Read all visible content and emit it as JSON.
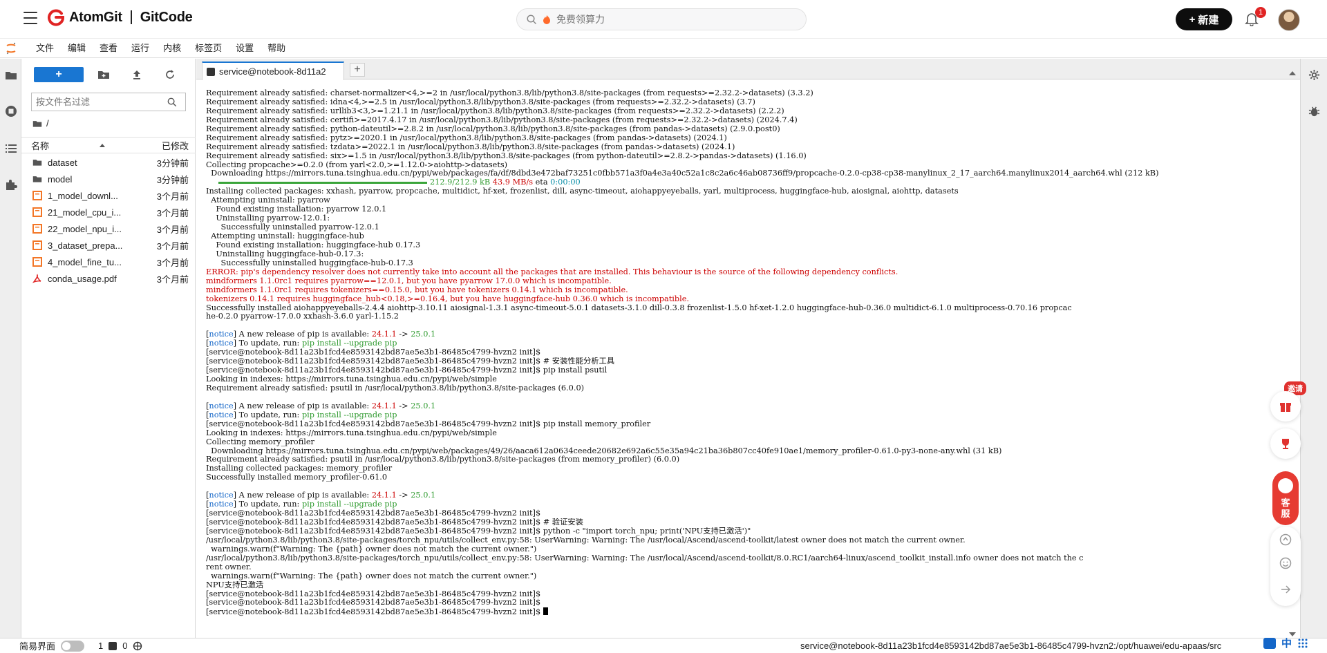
{
  "app": {
    "brand_left": "AtomGit",
    "brand_right": "GitCode",
    "search_placeholder": "免费领算力",
    "new_button": "新建",
    "notification_count": "1"
  },
  "menubar": [
    "文件",
    "编辑",
    "查看",
    "运行",
    "内核",
    "标签页",
    "设置",
    "帮助"
  ],
  "filebrowser": {
    "filter_placeholder": "按文件名过滤",
    "breadcrumb": "/",
    "col_name": "名称",
    "col_modified": "已修改",
    "files": [
      {
        "name": "dataset",
        "modified": "3分钟前",
        "type": "folder"
      },
      {
        "name": "model",
        "modified": "3分钟前",
        "type": "folder"
      },
      {
        "name": "1_model_downl...",
        "modified": "3个月前",
        "type": "notebook"
      },
      {
        "name": "21_model_cpu_i...",
        "modified": "3个月前",
        "type": "notebook"
      },
      {
        "name": "22_model_npu_i...",
        "modified": "3个月前",
        "type": "notebook"
      },
      {
        "name": "3_dataset_prepa...",
        "modified": "3个月前",
        "type": "notebook"
      },
      {
        "name": "4_model_fine_tu...",
        "modified": "3个月前",
        "type": "notebook"
      },
      {
        "name": "conda_usage.pdf",
        "modified": "3个月前",
        "type": "pdf"
      }
    ]
  },
  "terminal": {
    "tab_label": "service@notebook-8d11a2",
    "lines": [
      [
        {
          "t": "Requirement already satisfied: charset-normalizer<4,>=2 in /usr/local/python3.8/lib/python3.8/site-packages (from requests>=2.32.2->datasets) (3.3.2)"
        }
      ],
      [
        {
          "t": "Requirement already satisfied: idna<4,>=2.5 in /usr/local/python3.8/lib/python3.8/site-packages (from requests>=2.32.2->datasets) (3.7)"
        }
      ],
      [
        {
          "t": "Requirement already satisfied: urllib3<3,>=1.21.1 in /usr/local/python3.8/lib/python3.8/site-packages (from requests>=2.32.2->datasets) (2.2.2)"
        }
      ],
      [
        {
          "t": "Requirement already satisfied: certifi>=2017.4.17 in /usr/local/python3.8/lib/python3.8/site-packages (from requests>=2.32.2->datasets) (2024.7.4)"
        }
      ],
      [
        {
          "t": "Requirement already satisfied: python-dateutil>=2.8.2 in /usr/local/python3.8/lib/python3.8/site-packages (from pandas->datasets) (2.9.0.post0)"
        }
      ],
      [
        {
          "t": "Requirement already satisfied: pytz>=2020.1 in /usr/local/python3.8/lib/python3.8/site-packages (from pandas->datasets) (2024.1)"
        }
      ],
      [
        {
          "t": "Requirement already satisfied: tzdata>=2022.1 in /usr/local/python3.8/lib/python3.8/site-packages (from pandas->datasets) (2024.1)"
        }
      ],
      [
        {
          "t": "Requirement already satisfied: six>=1.5 in /usr/local/python3.8/lib/python3.8/site-packages (from python-dateutil>=2.8.2->pandas->datasets) (1.16.0)"
        }
      ],
      [
        {
          "t": "Collecting propcache>=0.2.0 (from yarl<2.0,>=1.12.0->aiohttp->datasets)"
        }
      ],
      [
        {
          "t": "  Downloading https://mirrors.tuna.tsinghua.edu.cn/pypi/web/packages/fa/df/8dbd3e472baf73251c0fbb571a3f0a4e3a40c52a1c8c2a6c46ab08736ff9/propcache-0.2.0-cp38-cp38-manylinux_2_17_aarch64.manylinux2014_aarch64.whl (212 kB)"
        }
      ],
      [
        {
          "t": "     "
        },
        {
          "bar": 1
        },
        {
          "t": "212.9/212.9 kB",
          "c": "c-green"
        },
        {
          "t": " "
        },
        {
          "t": "43.9 MB/s",
          "c": "c-red"
        },
        {
          "t": " eta "
        },
        {
          "t": "0:00:00",
          "c": "c-cyan"
        }
      ],
      [
        {
          "t": "Installing collected packages: xxhash, pyarrow, propcache, multidict, hf-xet, frozenlist, dill, async-timeout, aiohappyeyeballs, yarl, multiprocess, huggingface-hub, aiosignal, aiohttp, datasets"
        }
      ],
      [
        {
          "t": "  Attempting uninstall: pyarrow"
        }
      ],
      [
        {
          "t": "    Found existing installation: pyarrow 12.0.1"
        }
      ],
      [
        {
          "t": "    Uninstalling pyarrow-12.0.1:"
        }
      ],
      [
        {
          "t": "      Successfully uninstalled pyarrow-12.0.1"
        }
      ],
      [
        {
          "t": "  Attempting uninstall: huggingface-hub"
        }
      ],
      [
        {
          "t": "    Found existing installation: huggingface-hub 0.17.3"
        }
      ],
      [
        {
          "t": "    Uninstalling huggingface-hub-0.17.3:"
        }
      ],
      [
        {
          "t": "      Successfully uninstalled huggingface-hub-0.17.3"
        }
      ],
      [
        {
          "t": "ERROR: pip's dependency resolver does not currently take into account all the packages that are installed. This behaviour is the source of the following dependency conflicts.",
          "c": "c-red"
        }
      ],
      [
        {
          "t": "mindformers 1.1.0rc1 requires pyarrow==12.0.1, but you have pyarrow 17.0.0 which is incompatible.",
          "c": "c-red"
        }
      ],
      [
        {
          "t": "mindformers 1.1.0rc1 requires tokenizers==0.15.0, but you have tokenizers 0.14.1 which is incompatible.",
          "c": "c-red"
        }
      ],
      [
        {
          "t": "tokenizers 0.14.1 requires huggingface_hub<0.18,>=0.16.4, but you have huggingface-hub 0.36.0 which is incompatible.",
          "c": "c-red"
        }
      ],
      [
        {
          "t": "Successfully installed aiohappyeyeballs-2.4.4 aiohttp-3.10.11 aiosignal-1.3.1 async-timeout-5.0.1 datasets-3.1.0 dill-0.3.8 frozenlist-1.5.0 hf-xet-1.2.0 huggingface-hub-0.36.0 multidict-6.1.0 multiprocess-0.70.16 propcac"
        }
      ],
      [
        {
          "t": "he-0.2.0 pyarrow-17.0.0 xxhash-3.6.0 yarl-1.15.2"
        }
      ],
      [
        {
          "t": ""
        }
      ],
      [
        {
          "t": "["
        },
        {
          "t": "notice",
          "c": "c-blue"
        },
        {
          "t": "] A new release of pip is available: "
        },
        {
          "t": "24.1.1",
          "c": "c-red"
        },
        {
          "t": " -> "
        },
        {
          "t": "25.0.1",
          "c": "c-green"
        }
      ],
      [
        {
          "t": "["
        },
        {
          "t": "notice",
          "c": "c-blue"
        },
        {
          "t": "] To update, run: "
        },
        {
          "t": "pip install --upgrade pip",
          "c": "c-green"
        }
      ],
      [
        {
          "t": "[service@notebook-8d11a23b1fcd4e8593142bd87ae5e3b1-86485c4799-hvzn2 init]$"
        }
      ],
      [
        {
          "t": "[service@notebook-8d11a23b1fcd4e8593142bd87ae5e3b1-86485c4799-hvzn2 init]$ # 安装性能分析工具"
        }
      ],
      [
        {
          "t": "[service@notebook-8d11a23b1fcd4e8593142bd87ae5e3b1-86485c4799-hvzn2 init]$ pip install psutil"
        }
      ],
      [
        {
          "t": "Looking in indexes: https://mirrors.tuna.tsinghua.edu.cn/pypi/web/simple"
        }
      ],
      [
        {
          "t": "Requirement already satisfied: psutil in /usr/local/python3.8/lib/python3.8/site-packages (6.0.0)"
        }
      ],
      [
        {
          "t": ""
        }
      ],
      [
        {
          "t": "["
        },
        {
          "t": "notice",
          "c": "c-blue"
        },
        {
          "t": "] A new release of pip is available: "
        },
        {
          "t": "24.1.1",
          "c": "c-red"
        },
        {
          "t": " -> "
        },
        {
          "t": "25.0.1",
          "c": "c-green"
        }
      ],
      [
        {
          "t": "["
        },
        {
          "t": "notice",
          "c": "c-blue"
        },
        {
          "t": "] To update, run: "
        },
        {
          "t": "pip install --upgrade pip",
          "c": "c-green"
        }
      ],
      [
        {
          "t": "[service@notebook-8d11a23b1fcd4e8593142bd87ae5e3b1-86485c4799-hvzn2 init]$ pip install memory_profiler"
        }
      ],
      [
        {
          "t": "Looking in indexes: https://mirrors.tuna.tsinghua.edu.cn/pypi/web/simple"
        }
      ],
      [
        {
          "t": "Collecting memory_profiler"
        }
      ],
      [
        {
          "t": "  Downloading https://mirrors.tuna.tsinghua.edu.cn/pypi/web/packages/49/26/aaca612a0634ceede20682e692a6c55e35a94c21ba36b807cc40fe910ae1/memory_profiler-0.61.0-py3-none-any.whl (31 kB)"
        }
      ],
      [
        {
          "t": "Requirement already satisfied: psutil in /usr/local/python3.8/lib/python3.8/site-packages (from memory_profiler) (6.0.0)"
        }
      ],
      [
        {
          "t": "Installing collected packages: memory_profiler"
        }
      ],
      [
        {
          "t": "Successfully installed memory_profiler-0.61.0"
        }
      ],
      [
        {
          "t": ""
        }
      ],
      [
        {
          "t": "["
        },
        {
          "t": "notice",
          "c": "c-blue"
        },
        {
          "t": "] A new release of pip is available: "
        },
        {
          "t": "24.1.1",
          "c": "c-red"
        },
        {
          "t": " -> "
        },
        {
          "t": "25.0.1",
          "c": "c-green"
        }
      ],
      [
        {
          "t": "["
        },
        {
          "t": "notice",
          "c": "c-blue"
        },
        {
          "t": "] To update, run: "
        },
        {
          "t": "pip install --upgrade pip",
          "c": "c-green"
        }
      ],
      [
        {
          "t": "[service@notebook-8d11a23b1fcd4e8593142bd87ae5e3b1-86485c4799-hvzn2 init]$"
        }
      ],
      [
        {
          "t": "[service@notebook-8d11a23b1fcd4e8593142bd87ae5e3b1-86485c4799-hvzn2 init]$ # 验证安装"
        }
      ],
      [
        {
          "t": "[service@notebook-8d11a23b1fcd4e8593142bd87ae5e3b1-86485c4799-hvzn2 init]$ python -c \"import torch_npu; print('NPU支持已激活')\""
        }
      ],
      [
        {
          "t": "/usr/local/python3.8/lib/python3.8/site-packages/torch_npu/utils/collect_env.py:58: UserWarning: Warning: The /usr/local/Ascend/ascend-toolkit/latest owner does not match the current owner."
        }
      ],
      [
        {
          "t": "  warnings.warn(f\"Warning: The {path} owner does not match the current owner.\")"
        }
      ],
      [
        {
          "t": "/usr/local/python3.8/lib/python3.8/site-packages/torch_npu/utils/collect_env.py:58: UserWarning: Warning: The /usr/local/Ascend/ascend-toolkit/8.0.RC1/aarch64-linux/ascend_toolkit_install.info owner does not match the c"
        }
      ],
      [
        {
          "t": "rent owner."
        }
      ],
      [
        {
          "t": "  warnings.warn(f\"Warning: The {path} owner does not match the current owner.\")"
        }
      ],
      [
        {
          "t": "NPU支持已激活"
        }
      ],
      [
        {
          "t": "[service@notebook-8d11a23b1fcd4e8593142bd87ae5e3b1-86485c4799-hvzn2 init]$"
        }
      ],
      [
        {
          "t": "[service@notebook-8d11a23b1fcd4e8593142bd87ae5e3b1-86485c4799-hvzn2 init]$"
        }
      ],
      [
        {
          "t": "[service@notebook-8d11a23b1fcd4e8593142bd87ae5e3b1-86485c4799-hvzn2 init]$ "
        },
        {
          "cursor": 1
        }
      ]
    ]
  },
  "floating": {
    "invite": "邀请",
    "service_line1": "客",
    "service_line2": "服"
  },
  "statusbar": {
    "simple_mode": "简易界面",
    "count1": "1",
    "count2": "0",
    "path": "service@notebook-8d11a23b1fcd4e8593142bd87ae5e3b1-86485c4799-hvzn2:/opt/huawei/edu-apaas/src",
    "ime_lang": "中"
  },
  "colors": {
    "accent": "#1976d2",
    "brand_red": "#e02424",
    "error_red": "#cc0000"
  }
}
